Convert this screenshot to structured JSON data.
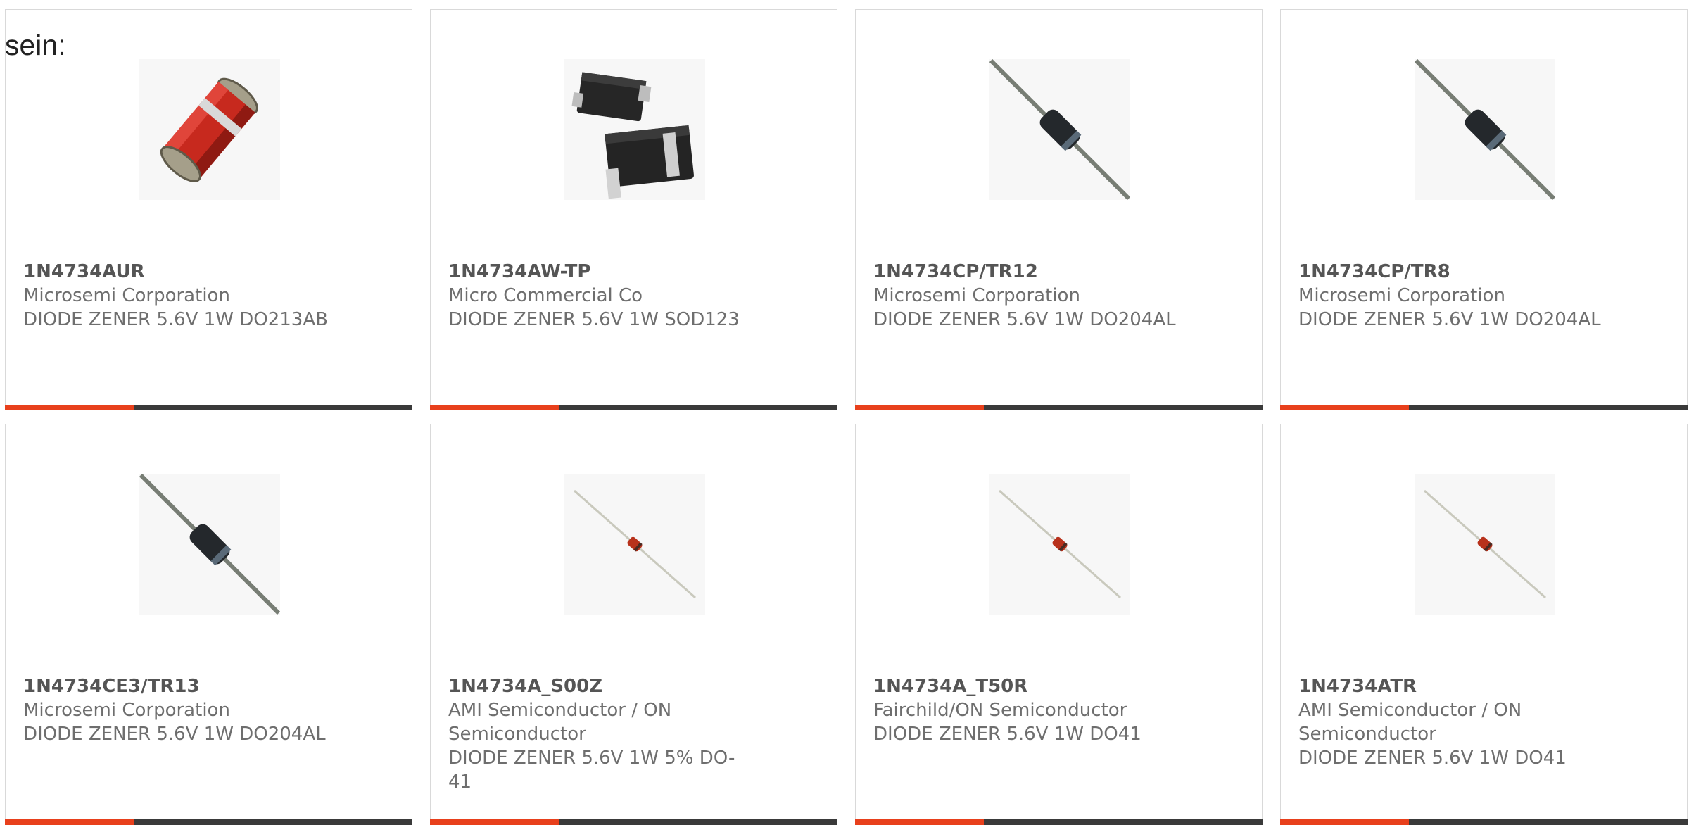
{
  "intro_text": "sein:",
  "colors": {
    "accent": "#e8401c",
    "bar_dark": "#3a3a3a",
    "card_border": "#d9d9d9",
    "text": "#6e6e6e"
  },
  "products": [
    {
      "part": "1N4734AUR",
      "maker": "Microsemi Corporation",
      "desc": "DIODE ZENER 5.6V 1W DO213AB",
      "image": "melf-diode-red"
    },
    {
      "part": "1N4734AW-TP",
      "maker": "Micro Commercial Co",
      "desc": "DIODE ZENER 5.6V 1W SOD123",
      "image": "smd-diode-sod123"
    },
    {
      "part": "1N4734CP/TR12",
      "maker": "Microsemi Corporation",
      "desc": "DIODE ZENER 5.6V 1W DO204AL",
      "image": "axial-diode-black"
    },
    {
      "part": "1N4734CP/TR8",
      "maker": "Microsemi Corporation",
      "desc": "DIODE ZENER 5.6V 1W DO204AL",
      "image": "axial-diode-black"
    },
    {
      "part": "1N4734CE3/TR13",
      "maker": "Microsemi Corporation",
      "desc": "DIODE ZENER 5.6V 1W DO204AL",
      "image": "axial-diode-black"
    },
    {
      "part": "1N4734A_S00Z",
      "maker": "AMI Semiconductor / ON Semiconductor",
      "desc": "DIODE ZENER 5.6V 1W 5% DO-41",
      "image": "axial-diode-small-red"
    },
    {
      "part": "1N4734A_T50R",
      "maker": "Fairchild/ON Semiconductor",
      "desc": "DIODE ZENER 5.6V 1W DO41",
      "image": "axial-diode-small-red"
    },
    {
      "part": "1N4734ATR",
      "maker": "AMI Semiconductor / ON Semiconductor",
      "desc": "DIODE ZENER 5.6V 1W DO41",
      "image": "axial-diode-small-red"
    }
  ]
}
